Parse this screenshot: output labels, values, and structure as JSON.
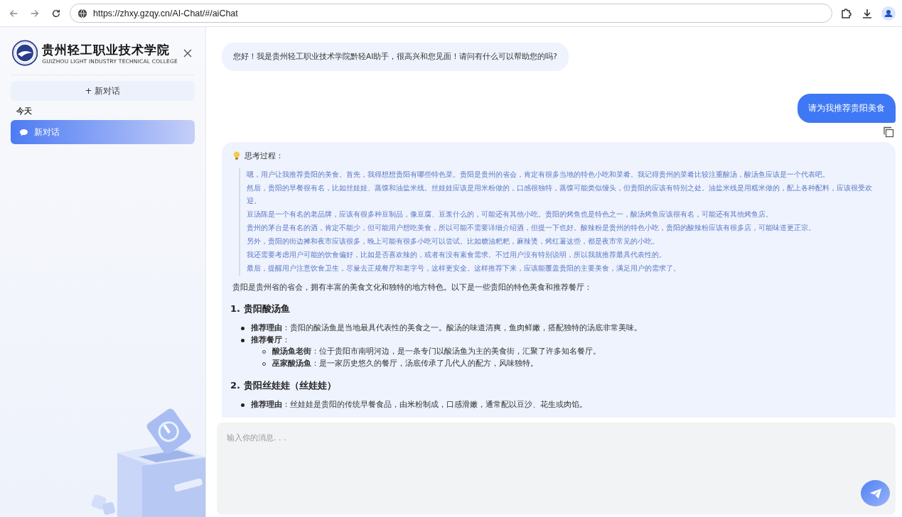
{
  "browser": {
    "url": "https://zhxy.gzqy.cn/AI-Chat/#/aiChat"
  },
  "sidebar": {
    "logo_title": "贵州轻工职业技术学院",
    "logo_subtitle": "GUIZHOU LIGHT INDUSTRY TECHNICAL COLLEGE",
    "new_chat_button": "+ 新对话",
    "section": "今天",
    "conversations": [
      {
        "label": "新对话",
        "selected": true
      }
    ]
  },
  "messages": [
    {
      "kind": "greeting",
      "text": "您好！我是贵州轻工职业技术学院黔轻AI助手，很高兴和您见面！请问有什么可以帮助您的吗?"
    },
    {
      "kind": "user",
      "text": "请为我推荐贵阳美食"
    },
    {
      "kind": "answer",
      "thinking_label": "思考过程：",
      "thinking": [
        "嗯，用户让我推荐贵阳的美食。首先，我得想想贵阳有哪些特色菜。贵阳是贵州的省会，肯定有很多当地的特色小吃和菜肴。我记得贵州的菜肴比较注重酸汤，酸汤鱼应该是一个代表吧。",
        "然后，贵阳的早餐很有名，比如丝娃娃、蒸馍和油盐米线。丝娃娃应该是用米粉做的，口感很独特，蒸馍可能类似馒头，但贵阳的应该有特别之处。油盐米线是用糯米做的，配上各种配料，应该很受欢迎。",
        "豆汤陈是一个有名的老品牌，应该有很多种豆制品，像豆腐、豆浆什么的，可能还有其他小吃。贵阳的烤鱼也是特色之一，酸汤烤鱼应该很有名，可能还有其他烤鱼店。",
        "贵州的茅台是有名的酒，肯定不能少，但可能用户想吃美食，所以可能不需要详细介绍酒，但提一下也好。酸辣粉是贵州的特色小吃，贵阳的酸辣粉应该有很多店，可能味道更正宗。",
        "另外，贵阳的街边摊和夜市应该很多，晚上可能有很多小吃可以尝试。比如糖油粑粑，麻辣烫，烤红薯这些，都是夜市常见的小吃。",
        "我还需要考虑用户可能的饮食偏好，比如是否喜欢辣的，或者有没有素食需求。不过用户没有特别说明，所以我就推荐最具代表性的。",
        "最后，提醒用户注意饮食卫生，尽量去正规餐厅和老字号，这样更安全。这样推荐下来，应该能覆盖贵阳的主要美食，满足用户的需求了。"
      ],
      "intro": "贵阳是贵州省的省会，拥有丰富的美食文化和独特的地方特色。以下是一些贵阳的特色美食和推荐餐厅：",
      "sections": [
        {
          "heading": "1. 贵阳酸汤鱼",
          "bullets": [
            {
              "text": "**推荐理由**：贵阳的酸汤鱼是当地最具代表性的美食之一。酸汤的味道清爽，鱼肉鲜嫩，搭配独特的汤底非常美味。"
            },
            {
              "text": "**推荐餐厅**：",
              "children": [
                {
                  "text": "**酸汤鱼老街**：位于贵阳市南明河边，是一条专门以酸汤鱼为主的美食街，汇聚了许多知名餐厅。"
                },
                {
                  "text": "**巫家酸汤鱼**：是一家历史悠久的餐厅，汤底传承了几代人的配方，风味独特。"
                }
              ]
            }
          ]
        },
        {
          "heading": "2. 贵阳丝娃娃（丝娃娃）",
          "bullets": [
            {
              "text": "**推荐理由**：丝娃娃是贵阳的传统早餐食品，由米粉制成，口感滑嫩，通常配以豆沙、花生或肉馅。"
            }
          ]
        }
      ]
    }
  ],
  "composer": {
    "placeholder": "输入你的消息. . ."
  }
}
